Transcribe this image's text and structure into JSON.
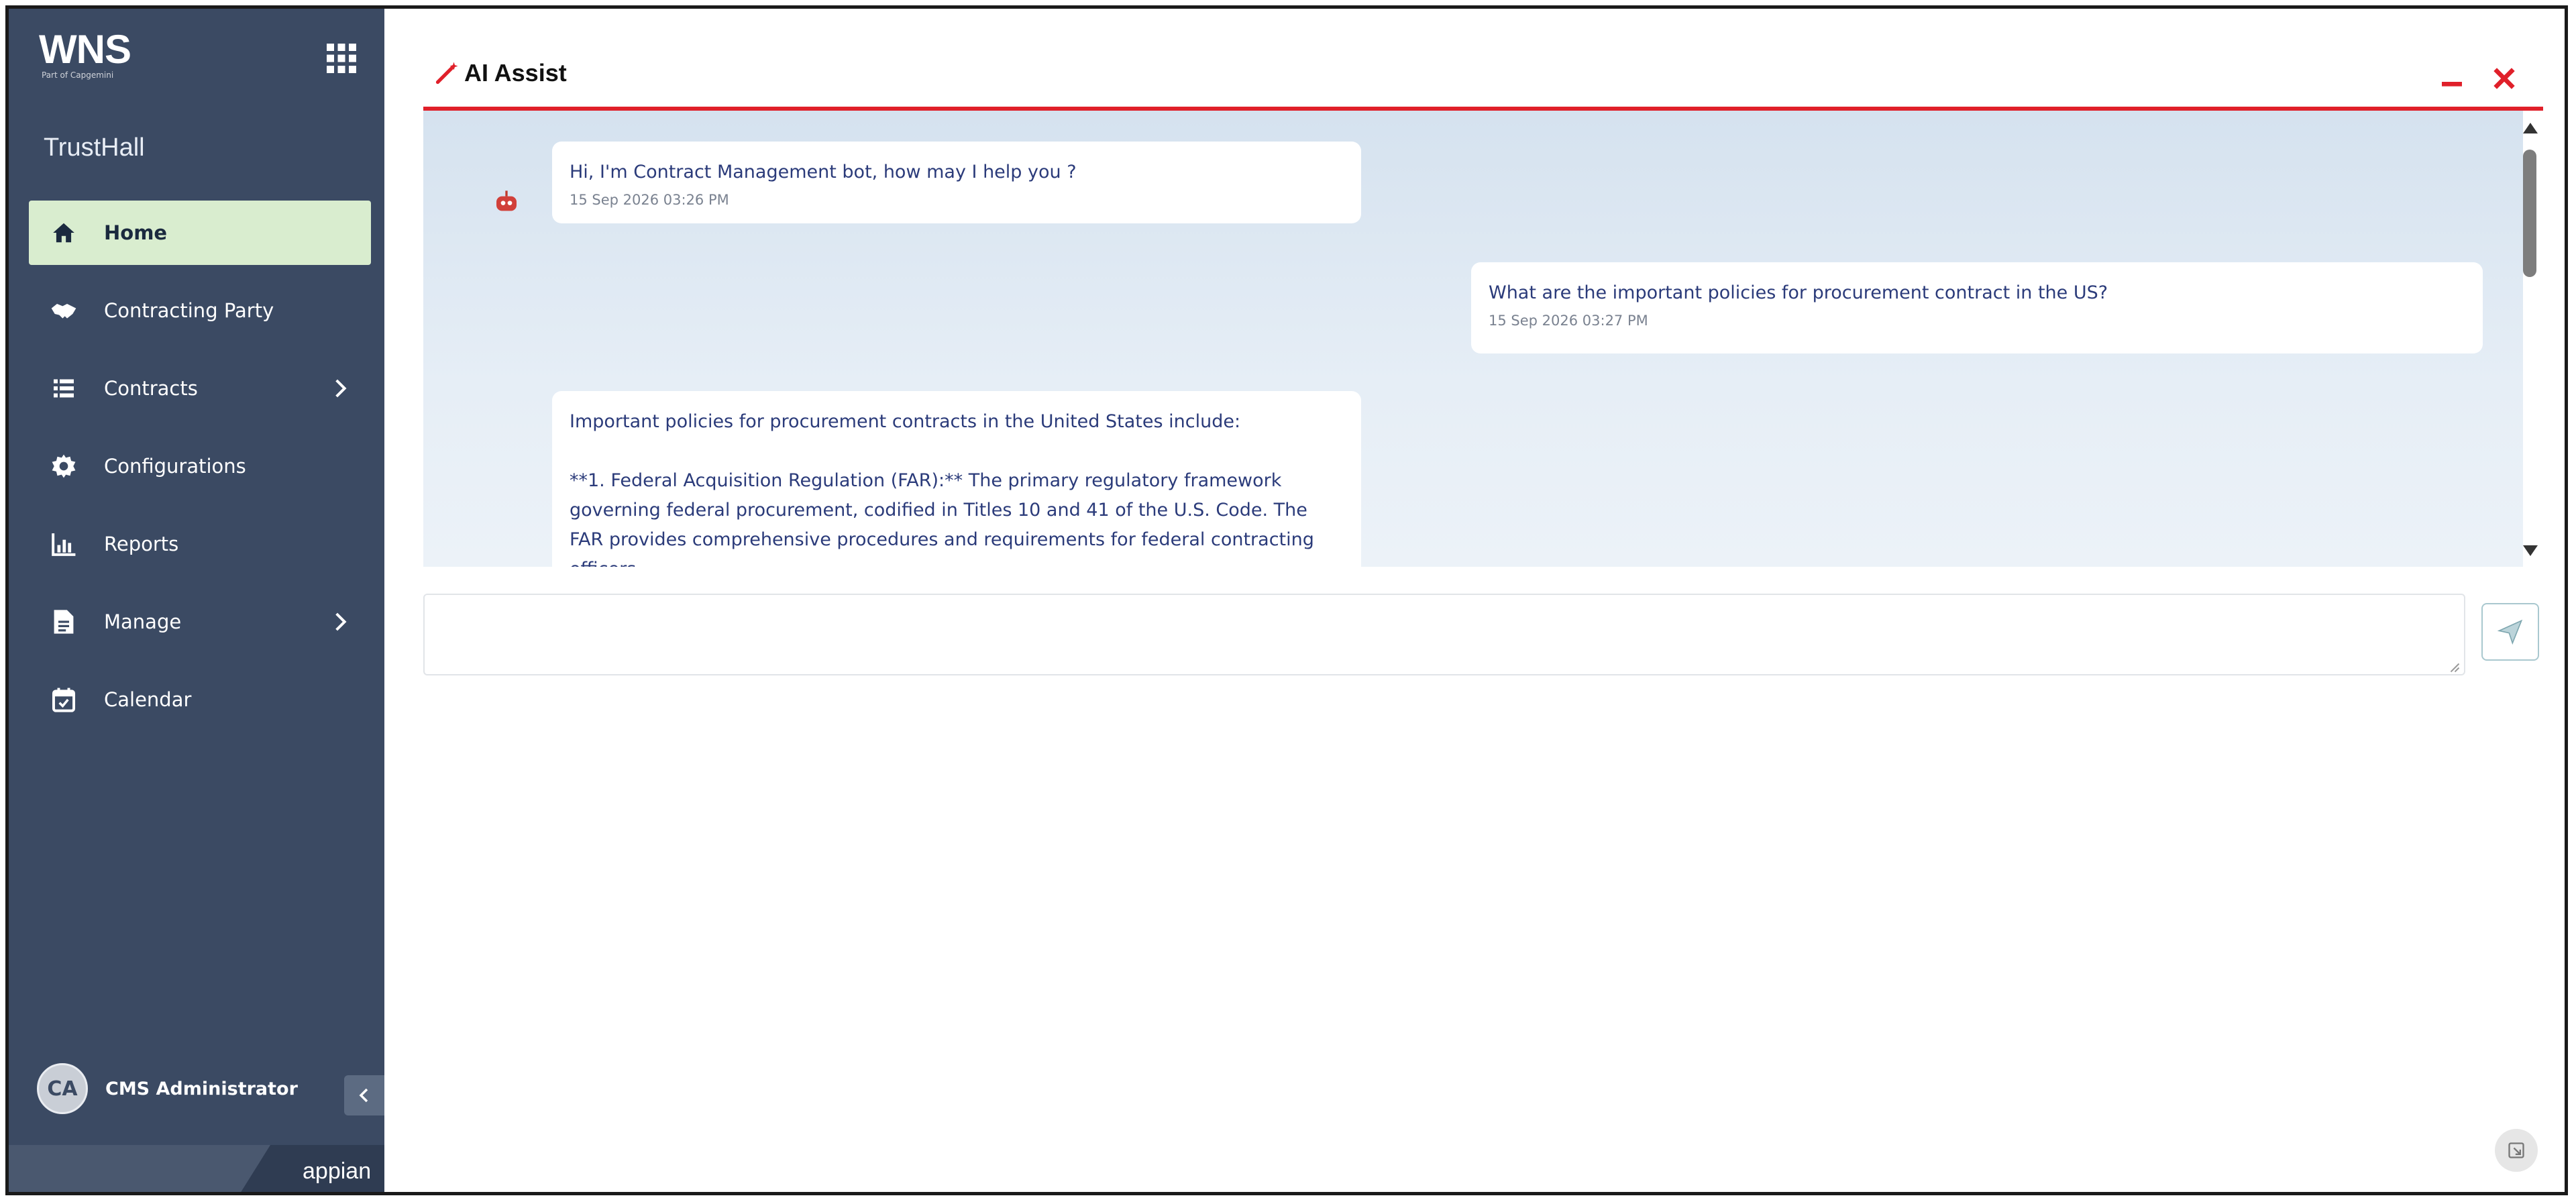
{
  "sidebar": {
    "logo": "WNS",
    "logo_tagline": "Part of Capgemini",
    "brand": "TrustHall",
    "items": [
      {
        "label": "Home",
        "icon": "home-icon",
        "active": true
      },
      {
        "label": "Contracting Party",
        "icon": "handshake-icon"
      },
      {
        "label": "Contracts",
        "icon": "list-icon",
        "has_children": true
      },
      {
        "label": "Configurations",
        "icon": "gear-icon"
      },
      {
        "label": "Reports",
        "icon": "chart-icon"
      },
      {
        "label": "Manage",
        "icon": "document-icon",
        "has_children": true
      },
      {
        "label": "Calendar",
        "icon": "calendar-icon"
      }
    ],
    "user": {
      "initials": "CA",
      "name": "CMS Administrator"
    },
    "footer": "appian",
    "colors": {
      "background": "#3b4a63",
      "active_item": "#d9edcf"
    }
  },
  "chat": {
    "title": "AI Assist",
    "accent_color": "#e0202a",
    "messages": [
      {
        "sender": "bot",
        "text": "Hi, I'm Contract Management bot, how may I help you ?",
        "time": "15 Sep 2026 03:26 PM"
      },
      {
        "sender": "user",
        "text": "What are the important policies for procurement contract in the US?",
        "time": "15 Sep 2026 03:27 PM"
      },
      {
        "sender": "bot",
        "text_intro": "Important policies for procurement contracts in the United States include:",
        "text_body": "**1. Federal Acquisition Regulation (FAR):** The primary regulatory framework governing federal procurement, codified in Titles 10 and 41 of the U.S. Code. The FAR provides comprehensive procedures and requirements for federal contracting officers"
      }
    ],
    "input": {
      "value": "",
      "placeholder": ""
    }
  }
}
